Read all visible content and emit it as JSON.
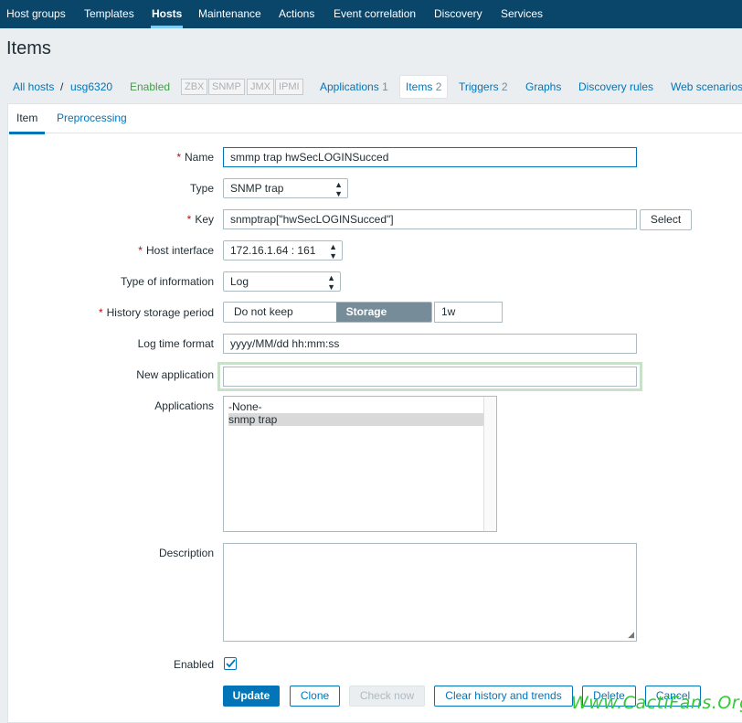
{
  "topnav": {
    "items": [
      "Host groups",
      "Templates",
      "Hosts",
      "Maintenance",
      "Actions",
      "Event correlation",
      "Discovery",
      "Services"
    ],
    "active": "Hosts"
  },
  "page": {
    "title": "Items"
  },
  "hostnav": {
    "all_hosts": "All hosts",
    "separator": "/",
    "host": "usg6320",
    "status": "Enabled",
    "badges": [
      "ZBX",
      "SNMP",
      "JMX",
      "IPMI"
    ],
    "applications": "Applications",
    "applications_count": "1",
    "items": "Items",
    "items_count": "2",
    "triggers": "Triggers",
    "triggers_count": "2",
    "graphs": "Graphs",
    "discovery_rules": "Discovery rules",
    "web_scenarios": "Web scenarios"
  },
  "tabs": {
    "item": "Item",
    "preprocessing": "Preprocessing"
  },
  "form": {
    "required_mark": "*",
    "name_label": "Name",
    "name_value": "smmp trap hwSecLOGINSucced",
    "type_label": "Type",
    "type_value": "SNMP trap",
    "key_label": "Key",
    "key_value": "snmptrap[\"hwSecLOGINSucced\"]",
    "key_select_button": "Select",
    "host_interface_label": "Host interface",
    "host_interface_value": "172.16.1.64 : 161",
    "type_of_info_label": "Type of information",
    "type_of_info_value": "Log",
    "history_label": "History storage period",
    "history_options": [
      "Do not keep history",
      "Storage period"
    ],
    "history_selected": "Storage period",
    "history_value": "1w",
    "log_time_format_label": "Log time format",
    "log_time_format_value": "yyyy/MM/dd hh:mm:ss",
    "new_application_label": "New application",
    "new_application_value": "",
    "applications_label": "Applications",
    "applications_options": [
      "-None-",
      "snmp trap"
    ],
    "applications_selected": "snmp trap",
    "description_label": "Description",
    "description_value": "",
    "enabled_label": "Enabled",
    "enabled_checked": true
  },
  "buttons": {
    "update": "Update",
    "clone": "Clone",
    "check_now": "Check now",
    "clear_history": "Clear history and trends",
    "delete": "Delete",
    "cancel": "Cancel"
  },
  "watermark": "Www.CactiFans.Org",
  "colors": {
    "nav_bg": "#0a466a",
    "link": "#0275b8",
    "enabled_green": "#429e47",
    "required_red": "#d40000",
    "selected_option_bg": "#768d99"
  }
}
